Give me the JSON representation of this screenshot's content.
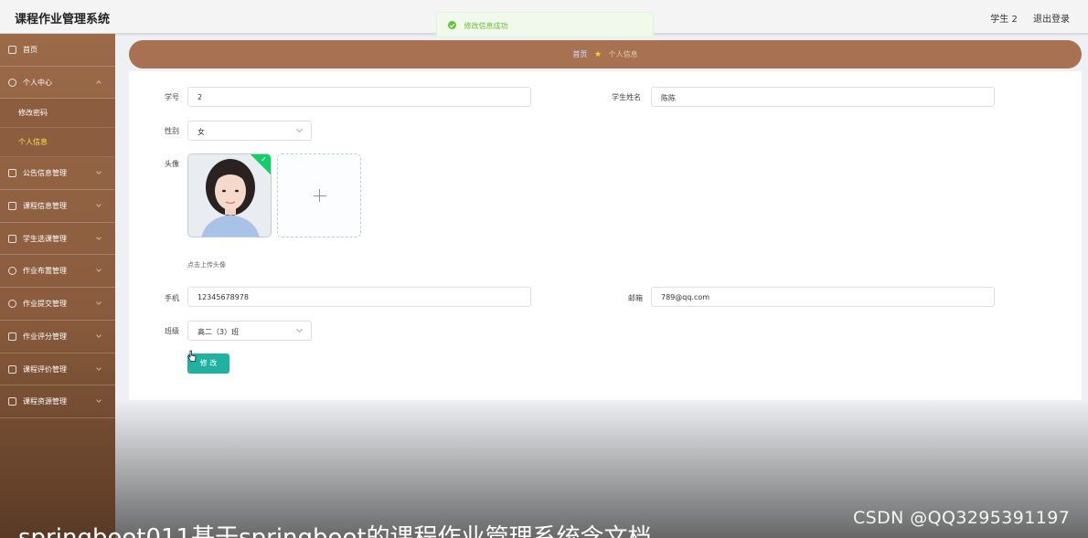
{
  "header": {
    "title": "课程作业管理系统",
    "user": "学生 2",
    "logout": "退出登录"
  },
  "toast": {
    "message": "修改信息成功"
  },
  "sidebar": {
    "items": [
      {
        "label": "首页",
        "icon": "home-icon"
      },
      {
        "label": "个人中心",
        "icon": "user-icon"
      },
      {
        "label": "公告信息管理",
        "icon": "notice-icon"
      },
      {
        "label": "课程信息管理",
        "icon": "course-icon"
      },
      {
        "label": "学生选课管理",
        "icon": "list-icon"
      },
      {
        "label": "作业布置管理",
        "icon": "clock-icon"
      },
      {
        "label": "作业提交管理",
        "icon": "question-icon"
      },
      {
        "label": "作业评分管理",
        "icon": "grid-icon"
      },
      {
        "label": "课程评价管理",
        "icon": "rating-icon"
      },
      {
        "label": "课程资源管理",
        "icon": "folder-icon"
      }
    ],
    "submenu": [
      "修改密码",
      "个人信息"
    ]
  },
  "breadcrumb": {
    "home": "首页",
    "current": "个人信息"
  },
  "form": {
    "student_id": {
      "label": "学号",
      "value": "2"
    },
    "student_name": {
      "label": "学生姓名",
      "value": "陈陈"
    },
    "gender": {
      "label": "性别",
      "value": "女"
    },
    "avatar": {
      "label": "头像",
      "hint": "点击上传头像"
    },
    "phone": {
      "label": "手机",
      "value": "12345678978"
    },
    "email": {
      "label": "邮箱",
      "value": "789@qq.com"
    },
    "class": {
      "label": "班级",
      "value": "高二（3）班"
    },
    "submit_label": "修 改"
  },
  "overlay": {
    "watermark": "CSDN @QQ3295391197",
    "caption": "springboot011基于springboot的课程作业管理系统含文档"
  },
  "colors": {
    "sidebar": "#9a6a49",
    "breadcrumb": "#a87252",
    "button": "#20b2a0",
    "toast": "#67c23a"
  }
}
